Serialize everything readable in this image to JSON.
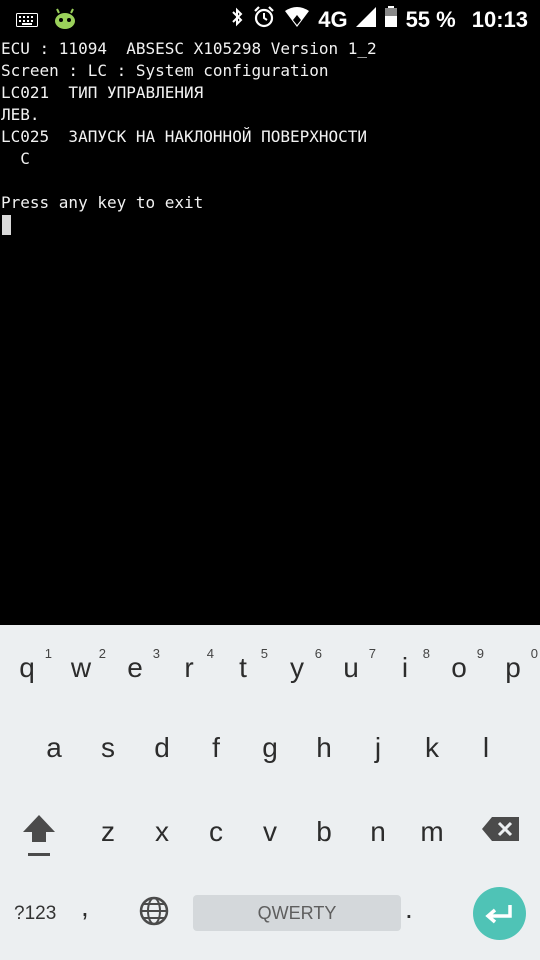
{
  "status_bar": {
    "battery": "55 %",
    "network": "4G",
    "time": "10:13"
  },
  "terminal": {
    "lines": [
      "ECU : 11094  ABSESC X105298 Version 1_2",
      "Screen : LC : System configuration",
      "LC021  ТИП УПРАВЛЕНИЯ",
      "ЛЕВ.",
      "LC025  ЗАПУСК НА НАКЛОННОЙ ПОВЕРХНОСТИ",
      "  C",
      "",
      "Press any key to exit"
    ]
  },
  "keyboard": {
    "row1": [
      {
        "key": "q",
        "hint": "1"
      },
      {
        "key": "w",
        "hint": "2"
      },
      {
        "key": "e",
        "hint": "3"
      },
      {
        "key": "r",
        "hint": "4"
      },
      {
        "key": "t",
        "hint": "5"
      },
      {
        "key": "y",
        "hint": "6"
      },
      {
        "key": "u",
        "hint": "7"
      },
      {
        "key": "i",
        "hint": "8"
      },
      {
        "key": "o",
        "hint": "9"
      },
      {
        "key": "p",
        "hint": "0"
      }
    ],
    "row2": [
      "a",
      "s",
      "d",
      "f",
      "g",
      "h",
      "j",
      "k",
      "l"
    ],
    "row3": [
      "z",
      "x",
      "c",
      "v",
      "b",
      "n",
      "m"
    ],
    "symbols_label": "?123",
    "comma": ",",
    "space_label": "QWERTY",
    "period": "."
  }
}
